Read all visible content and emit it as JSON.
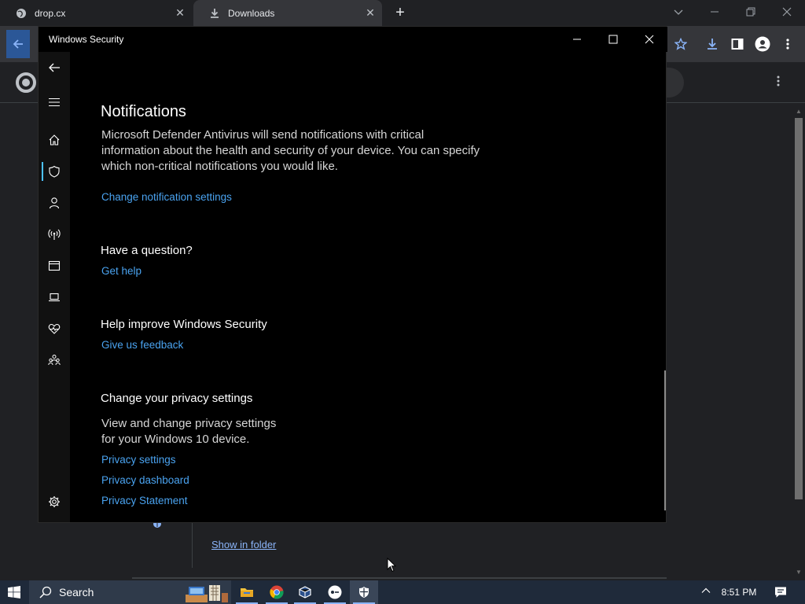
{
  "browser": {
    "tabs": [
      {
        "title": "drop.cx",
        "icon": "globe-icon",
        "active": false
      },
      {
        "title": "Downloads",
        "icon": "download-icon",
        "active": true
      }
    ],
    "new_tab_symbol": "+",
    "downloads_page": {
      "show_in_folder": "Show in folder"
    },
    "accent_color": "#8ab4f8"
  },
  "ws_window": {
    "title": "Windows Security",
    "nav": [
      {
        "id": "back",
        "icon": "back-arrow-icon"
      },
      {
        "id": "menu",
        "icon": "hamburger-icon"
      },
      {
        "id": "home",
        "icon": "home-icon"
      },
      {
        "id": "virus",
        "icon": "shield-icon",
        "selected": true
      },
      {
        "id": "account",
        "icon": "person-icon"
      },
      {
        "id": "firewall",
        "icon": "antenna-icon"
      },
      {
        "id": "app-browser",
        "icon": "browser-window-icon"
      },
      {
        "id": "device-security",
        "icon": "laptop-icon"
      },
      {
        "id": "device-health",
        "icon": "heart-pulse-icon"
      },
      {
        "id": "family",
        "icon": "family-icon"
      },
      {
        "id": "settings",
        "icon": "gear-icon"
      }
    ],
    "notifications": {
      "title": "Notifications",
      "text_lines": [
        "Microsoft Defender Antivirus will send notifications with critical",
        "information about the health and security of your device. You can specify",
        "which non-critical notifications you would like."
      ],
      "link": "Change notification settings"
    },
    "question": {
      "title": "Have a question?",
      "link": "Get help"
    },
    "improve": {
      "title": "Help improve Windows Security",
      "link": "Give us feedback"
    },
    "privacy": {
      "title": "Change your privacy settings",
      "text_lines": [
        "View and change privacy settings",
        "for your Windows 10 device."
      ],
      "links": [
        "Privacy settings",
        "Privacy dashboard",
        "Privacy Statement"
      ]
    },
    "link_color": "#4aa3f0"
  },
  "taskbar": {
    "search_placeholder": "Search",
    "apps": [
      {
        "name": "file-explorer-icon"
      },
      {
        "name": "chrome-icon"
      },
      {
        "name": "virtualbox-icon"
      },
      {
        "name": "app-circle-icon"
      },
      {
        "name": "windows-security-icon",
        "active": true
      }
    ],
    "clock": "8:51 PM"
  }
}
